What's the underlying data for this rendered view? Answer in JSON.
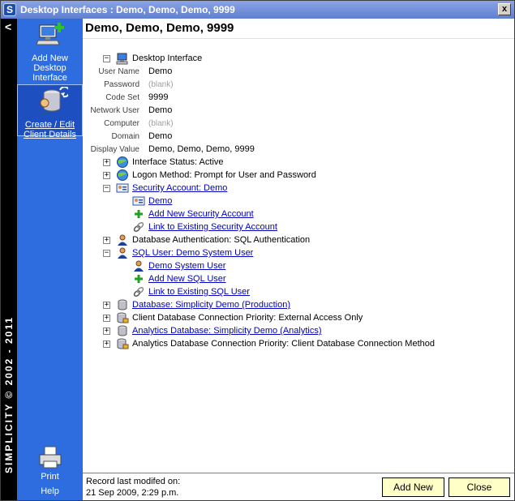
{
  "window": {
    "title": "Desktop Interfaces : Demo, Demo, Demo, 9999",
    "app_icon_letter": "S",
    "close_glyph": "x"
  },
  "leftstrip": {
    "back_glyph": "<",
    "brand": "SIMPLICITY © 2002 - 2011"
  },
  "sidebar": {
    "add_new": "Add New Desktop Interface",
    "create_edit": "Create / Edit Client Details",
    "print": "Print",
    "help": "Help"
  },
  "header": {
    "title": "Demo, Demo, Demo, 9999"
  },
  "tree": {
    "root": "Desktop Interface",
    "properties": [
      {
        "label": "User Name",
        "value": "Demo",
        "blank": false
      },
      {
        "label": "Password",
        "value": "(blank)",
        "blank": true
      },
      {
        "label": "Code Set",
        "value": "9999",
        "blank": false
      },
      {
        "label": "Network User",
        "value": "Demo",
        "blank": false
      },
      {
        "label": "Computer",
        "value": "(blank)",
        "blank": true
      },
      {
        "label": "Domain",
        "value": "Demo",
        "blank": false
      },
      {
        "label": "Display Value",
        "value": "Demo, Demo, Demo, 9999",
        "blank": false
      }
    ],
    "interface_status": "Interface Status:  Active",
    "logon_method": "Logon Method:  Prompt for User and Password",
    "security_account": "Security Account:  Demo",
    "security_child_demo": "Demo",
    "add_security_account": "Add New Security Account",
    "link_security_account": "Link to Existing Security Account",
    "database_auth": "Database Authentication:  SQL Authentication",
    "sql_user": "SQL User:  Demo System User",
    "sql_child_user": "Demo System User",
    "add_sql_user": "Add New SQL User",
    "link_sql_user": "Link to Existing SQL User",
    "database": "Database:  Simplicity Demo (Production)",
    "client_db_priority": "Client Database Connection Priority:  External Access Only",
    "analytics_db": "Analytics Database:  Simplicity Demo (Analytics)",
    "analytics_db_priority": "Analytics Database Connection Priority:  Client Database Connection Method"
  },
  "footer": {
    "modified_label": "Record last modifed on:",
    "modified_value": "21 Sep 2009, 2:29 p.m.",
    "add_new": "Add New",
    "close": "Close"
  },
  "colors": {
    "sidebar": "#2d6de0",
    "link": "#0000c0",
    "button_bg": "#ffffc8"
  }
}
